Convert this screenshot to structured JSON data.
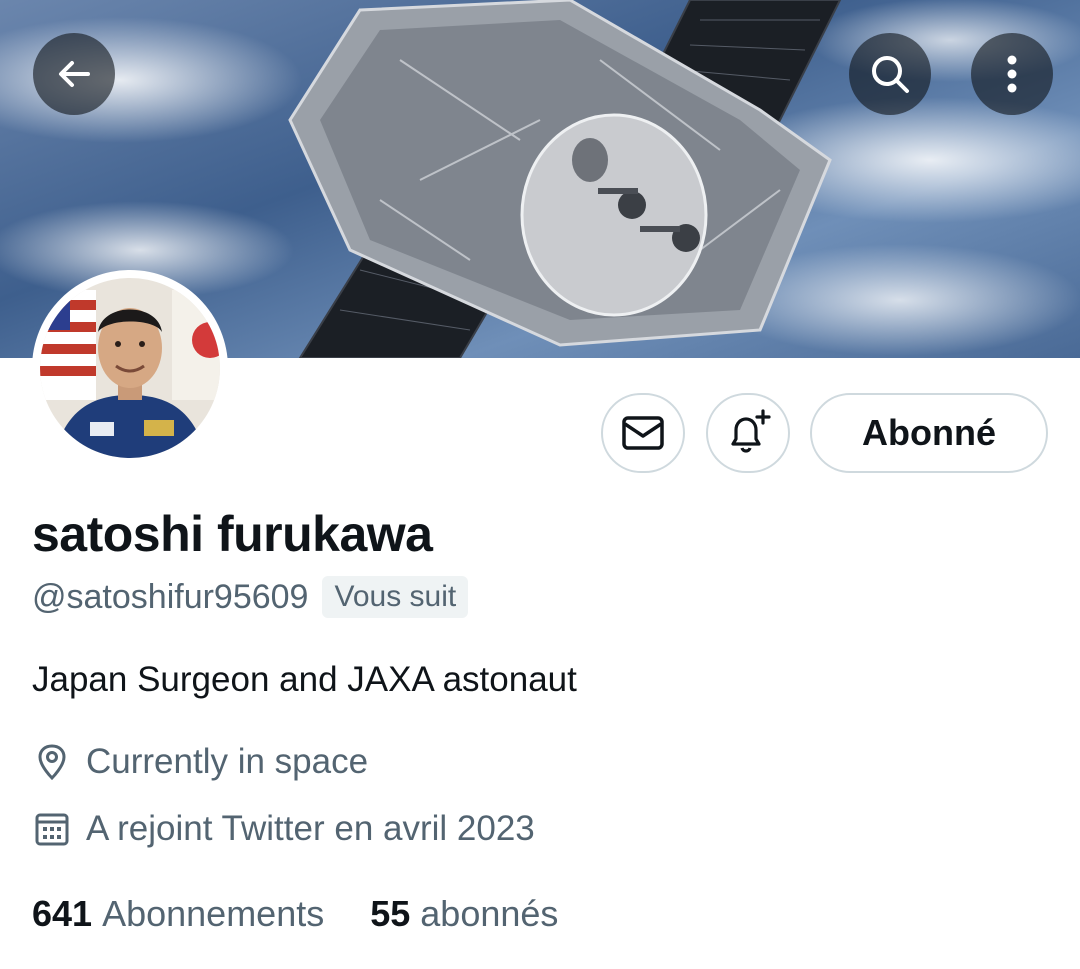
{
  "header": {
    "back_icon": "arrow-left-icon",
    "search_icon": "search-icon",
    "more_icon": "more-vertical-icon"
  },
  "actions": {
    "message_icon": "envelope-icon",
    "notify_icon": "bell-plus-icon",
    "follow_label": "Abonné"
  },
  "profile": {
    "name": "satoshi furukawa",
    "handle": "@satoshifur95609",
    "follows_you": "Vous suit",
    "bio": "Japan Surgeon and JAXA astonaut",
    "location": "Currently in space",
    "joined": "A rejoint Twitter en avril 2023"
  },
  "stats": {
    "following_count": "641",
    "following_label": "Abonnements",
    "followers_count": "55",
    "followers_label": "abonnés"
  },
  "colors": {
    "text_primary": "#0f1419",
    "text_secondary": "#536471",
    "border": "#cfd9de"
  }
}
